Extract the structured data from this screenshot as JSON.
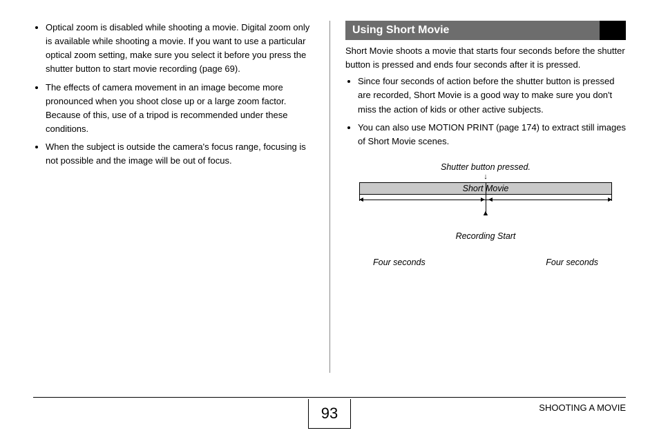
{
  "left_column": {
    "bullets": [
      "Optical zoom is disabled while shooting a movie. Digital zoom only is available while shooting a movie. If you want to use a particular optical zoom setting, make sure you select it before you press the shutter button to start movie recording (page 69).",
      "The effects of camera movement in an image become more pronounced when you shoot close up or a large zoom factor. Because of this, use of a tripod is recommended under these conditions.",
      "When the subject is outside the camera's focus range, focusing is not possible and the image will be out of focus."
    ]
  },
  "right_column": {
    "heading": "Using Short Movie",
    "intro": "Short Movie shoots a movie that starts four seconds before the shutter button is pressed and ends four seconds after it is pressed.",
    "bullets": [
      "Since four seconds of action before the shutter button is pressed are recorded, Short Movie is a good way to make sure you don't miss the action of kids or other active subjects.",
      "You can also use MOTION PRINT (page 174) to extract still images of Short Movie scenes."
    ],
    "diagram": {
      "top_label": "Shutter button pressed.",
      "bar_label": "Short Movie",
      "recording_label": "Recording Start",
      "left_duration": "Four seconds",
      "right_duration": "Four seconds"
    }
  },
  "footer": {
    "page_number": "93",
    "section": "SHOOTING A MOVIE"
  }
}
